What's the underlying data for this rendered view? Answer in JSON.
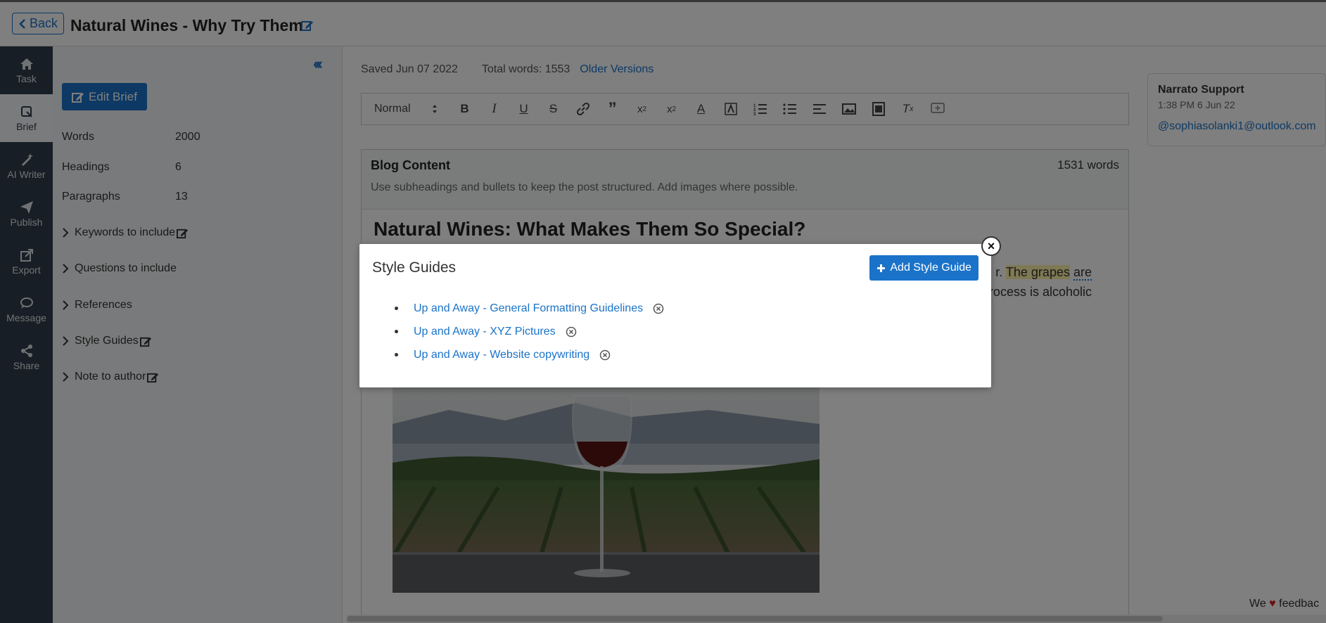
{
  "header": {
    "back_label": "Back",
    "title": "Natural Wines - Why Try Them"
  },
  "nav": {
    "items": [
      {
        "label": "Task",
        "icon": "home-icon"
      },
      {
        "label": "Brief",
        "icon": "brief-icon"
      },
      {
        "label": "AI Writer",
        "icon": "ai-writer-icon"
      },
      {
        "label": "Publish",
        "icon": "publish-icon"
      },
      {
        "label": "Export",
        "icon": "export-icon"
      },
      {
        "label": "Message",
        "icon": "message-icon"
      },
      {
        "label": "Share",
        "icon": "share-icon"
      }
    ],
    "active": "Brief"
  },
  "brief": {
    "collapse_label": "‹‹‹",
    "edit_button": "Edit Brief",
    "stats": [
      {
        "label": "Words",
        "value": "2000"
      },
      {
        "label": "Headings",
        "value": "6"
      },
      {
        "label": "Paragraphs",
        "value": "13"
      }
    ],
    "sections": [
      {
        "label": "Keywords to include",
        "editable": true
      },
      {
        "label": "Questions to include",
        "editable": false
      },
      {
        "label": "References",
        "editable": false
      },
      {
        "label": "Style Guides",
        "editable": true
      },
      {
        "label": "Note to author",
        "editable": true
      }
    ]
  },
  "editor": {
    "saved": "Saved Jun 07 2022",
    "total_words": "Total words: 1553",
    "older_versions": "Older Versions",
    "format_select": "Normal",
    "content_title": "Blog Content",
    "content_count": "1531 words",
    "content_hint": "Use subheadings and bullets to keep the post structured. Add images where possible.",
    "article_heading": "Natural Wines: What Makes Them So Special?",
    "body_line1_pre": "r. ",
    "body_line1_hl": "The grapes",
    "body_line1_post": "are",
    "body_line2": "rocess is alcoholic"
  },
  "comment": {
    "author": "Narrato Support",
    "time": "1:38 PM 6 Jun 22",
    "email": "@sophiasolanki1@outlook.com"
  },
  "feedback": {
    "pre": "We",
    "post": "feedbac"
  },
  "modal": {
    "title": "Style Guides",
    "add_button": "Add Style Guide",
    "close_label": "×",
    "items": [
      "Up and Away - General Formatting Guidelines",
      "Up and Away - XYZ Pictures",
      "Up and Away - Website copywriting"
    ]
  },
  "colors": {
    "accent": "#1a73c9",
    "sidebar": "#2f3d4a"
  }
}
